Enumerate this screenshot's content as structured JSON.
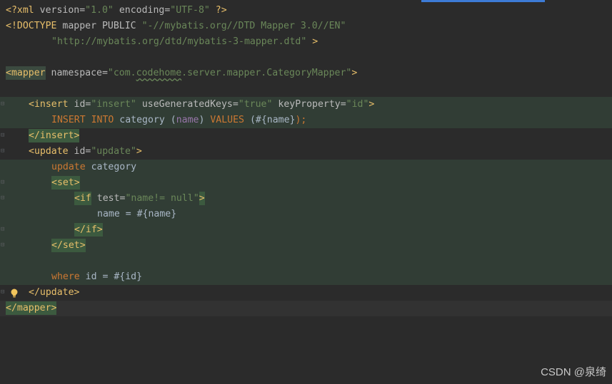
{
  "code": {
    "l1_decl_open": "<?xml",
    "l1_version_attr": " version=",
    "l1_version_val": "\"1.0\"",
    "l1_encoding_attr": " encoding=",
    "l1_encoding_val": "\"UTF-8\"",
    "l1_decl_close": " ?>",
    "l2_doctype_open": "<!DOCTYPE",
    "l2_doctype_name": " mapper PUBLIC ",
    "l2_public_id": "\"-//mybatis.org//DTD Mapper 3.0//EN\"",
    "l3_system_id": "\"http://mybatis.org/dtd/mybatis-3-mapper.dtd\"",
    "l3_close": " >",
    "l5_mapper_open": "<mapper",
    "l5_namespace_attr": " namespace=",
    "l5_namespace_q1": "\"com.",
    "l5_namespace_squiggle": "codehome",
    "l5_namespace_rest": ".server.mapper.CategoryMapper\"",
    "l5_mapper_close": ">",
    "l7_insert_open": "<insert",
    "l7_id_attr": " id=",
    "l7_id_val": "\"insert\"",
    "l7_ugk_attr": " useGeneratedKeys=",
    "l7_ugk_val": "\"true\"",
    "l7_kp_attr": " keyProperty=",
    "l7_kp_val": "\"id\"",
    "l7_close": ">",
    "l8_insert_kw": "INSERT INTO",
    "l8_table": " category ",
    "l8_paren_open": "(",
    "l8_col": "name",
    "l8_paren_close": ")",
    "l8_values_kw": " VALUES",
    "l8_values_open": " (",
    "l8_param": "#{name}",
    "l8_values_close": ");",
    "l9_insert_end": "</insert>",
    "l10_update_open": "<update",
    "l10_id_attr": " id=",
    "l10_id_val": "\"update\"",
    "l10_close": ">",
    "l11_update_kw": "update",
    "l11_table": " category",
    "l12_set_open": "<set>",
    "l13_if_open": "<if",
    "l13_test_attr": " test=",
    "l13_test_val": "\"name!= null\"",
    "l13_if_close": ">",
    "l14_assign": "name = #{name}",
    "l15_if_end": "</if>",
    "l16_set_end": "</set>",
    "l18_where_kw": "where",
    "l18_where_rest": " id = #{id}",
    "l19_update_end": "</update>",
    "l20_mapper_end": "</mapper>"
  },
  "icons": {
    "fold_marker": "fold-marker-icon",
    "intention_bulb": "lightbulb-icon"
  },
  "colors": {
    "background": "#2b2b2b",
    "tag": "#e8bf6a",
    "attribute": "#bababa",
    "string": "#6a8759",
    "keyword": "#cc7832",
    "column": "#9876aa",
    "injected_bg": "#313d35",
    "scroll_indicator": "#3d7bd6"
  },
  "watermark": {
    "text": "CSDN @泉绮"
  }
}
